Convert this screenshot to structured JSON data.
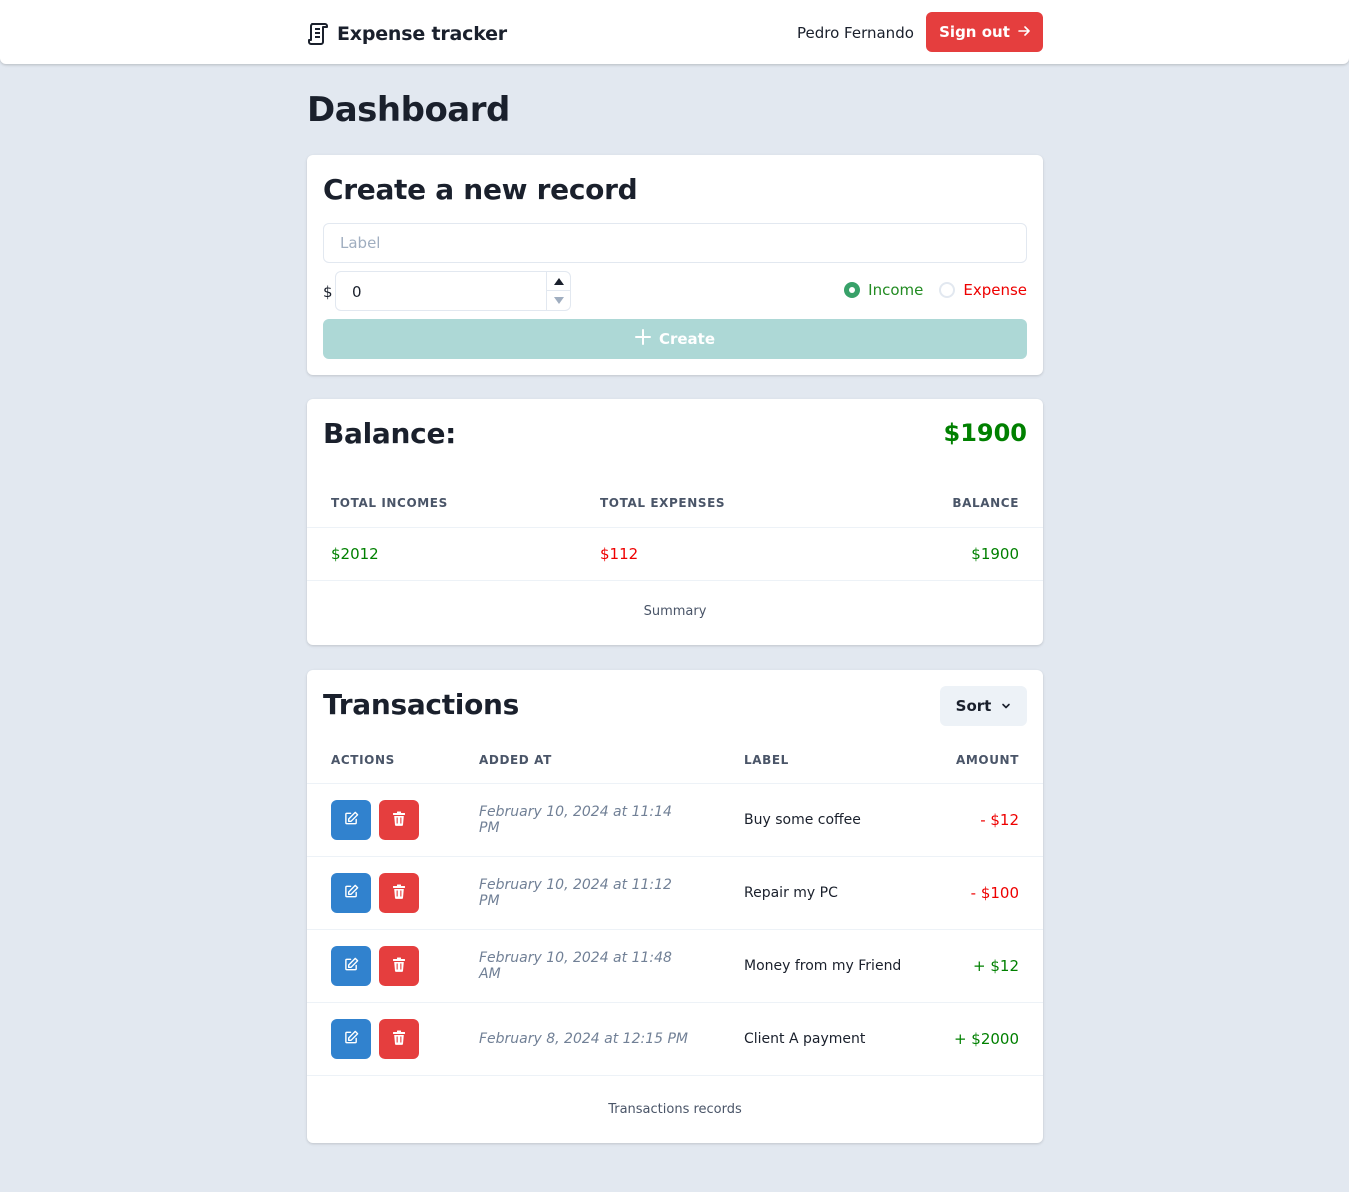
{
  "header": {
    "app_title": "Expense tracker",
    "user_name": "Pedro Fernando",
    "sign_out_label": "Sign out"
  },
  "page_title": "Dashboard",
  "create_form": {
    "title": "Create a new record",
    "label_placeholder": "Label",
    "currency_symbol": "$",
    "amount_value": "0",
    "type_options": [
      {
        "label": "Income",
        "checked": true
      },
      {
        "label": "Expense",
        "checked": false
      }
    ],
    "create_label": "Create"
  },
  "balance": {
    "title": "Balance:",
    "value": "$1900",
    "columns": [
      "Total incomes",
      "Total expenses",
      "Balance"
    ],
    "row": {
      "total_incomes": "$2012",
      "total_expenses": "$112",
      "balance": "$1900"
    },
    "caption": "Summary"
  },
  "transactions": {
    "title": "Transactions",
    "sort_label": "Sort",
    "columns": [
      "Actions",
      "Added at",
      "Label",
      "Amount"
    ],
    "rows": [
      {
        "added_at": "February 10, 2024 at 11:14 PM",
        "label": "Buy some coffee",
        "amount": "- $12",
        "kind": "expense"
      },
      {
        "added_at": "February 10, 2024 at 11:12 PM",
        "label": "Repair my PC",
        "amount": "- $100",
        "kind": "expense"
      },
      {
        "added_at": "February 10, 2024 at 11:48 AM",
        "label": "Money from my Friend",
        "amount": "+ $12",
        "kind": "income"
      },
      {
        "added_at": "February 8, 2024 at 12:15 PM",
        "label": "Client A payment",
        "amount": "+ $2000",
        "kind": "income"
      }
    ],
    "caption": "Transactions records"
  },
  "colors": {
    "page_bg": "#e2e8f0",
    "income": "#008000",
    "expense": "#ee0000",
    "danger": "#e53e3e",
    "primary": "#3182ce",
    "create_disabled": "#add8d6"
  }
}
